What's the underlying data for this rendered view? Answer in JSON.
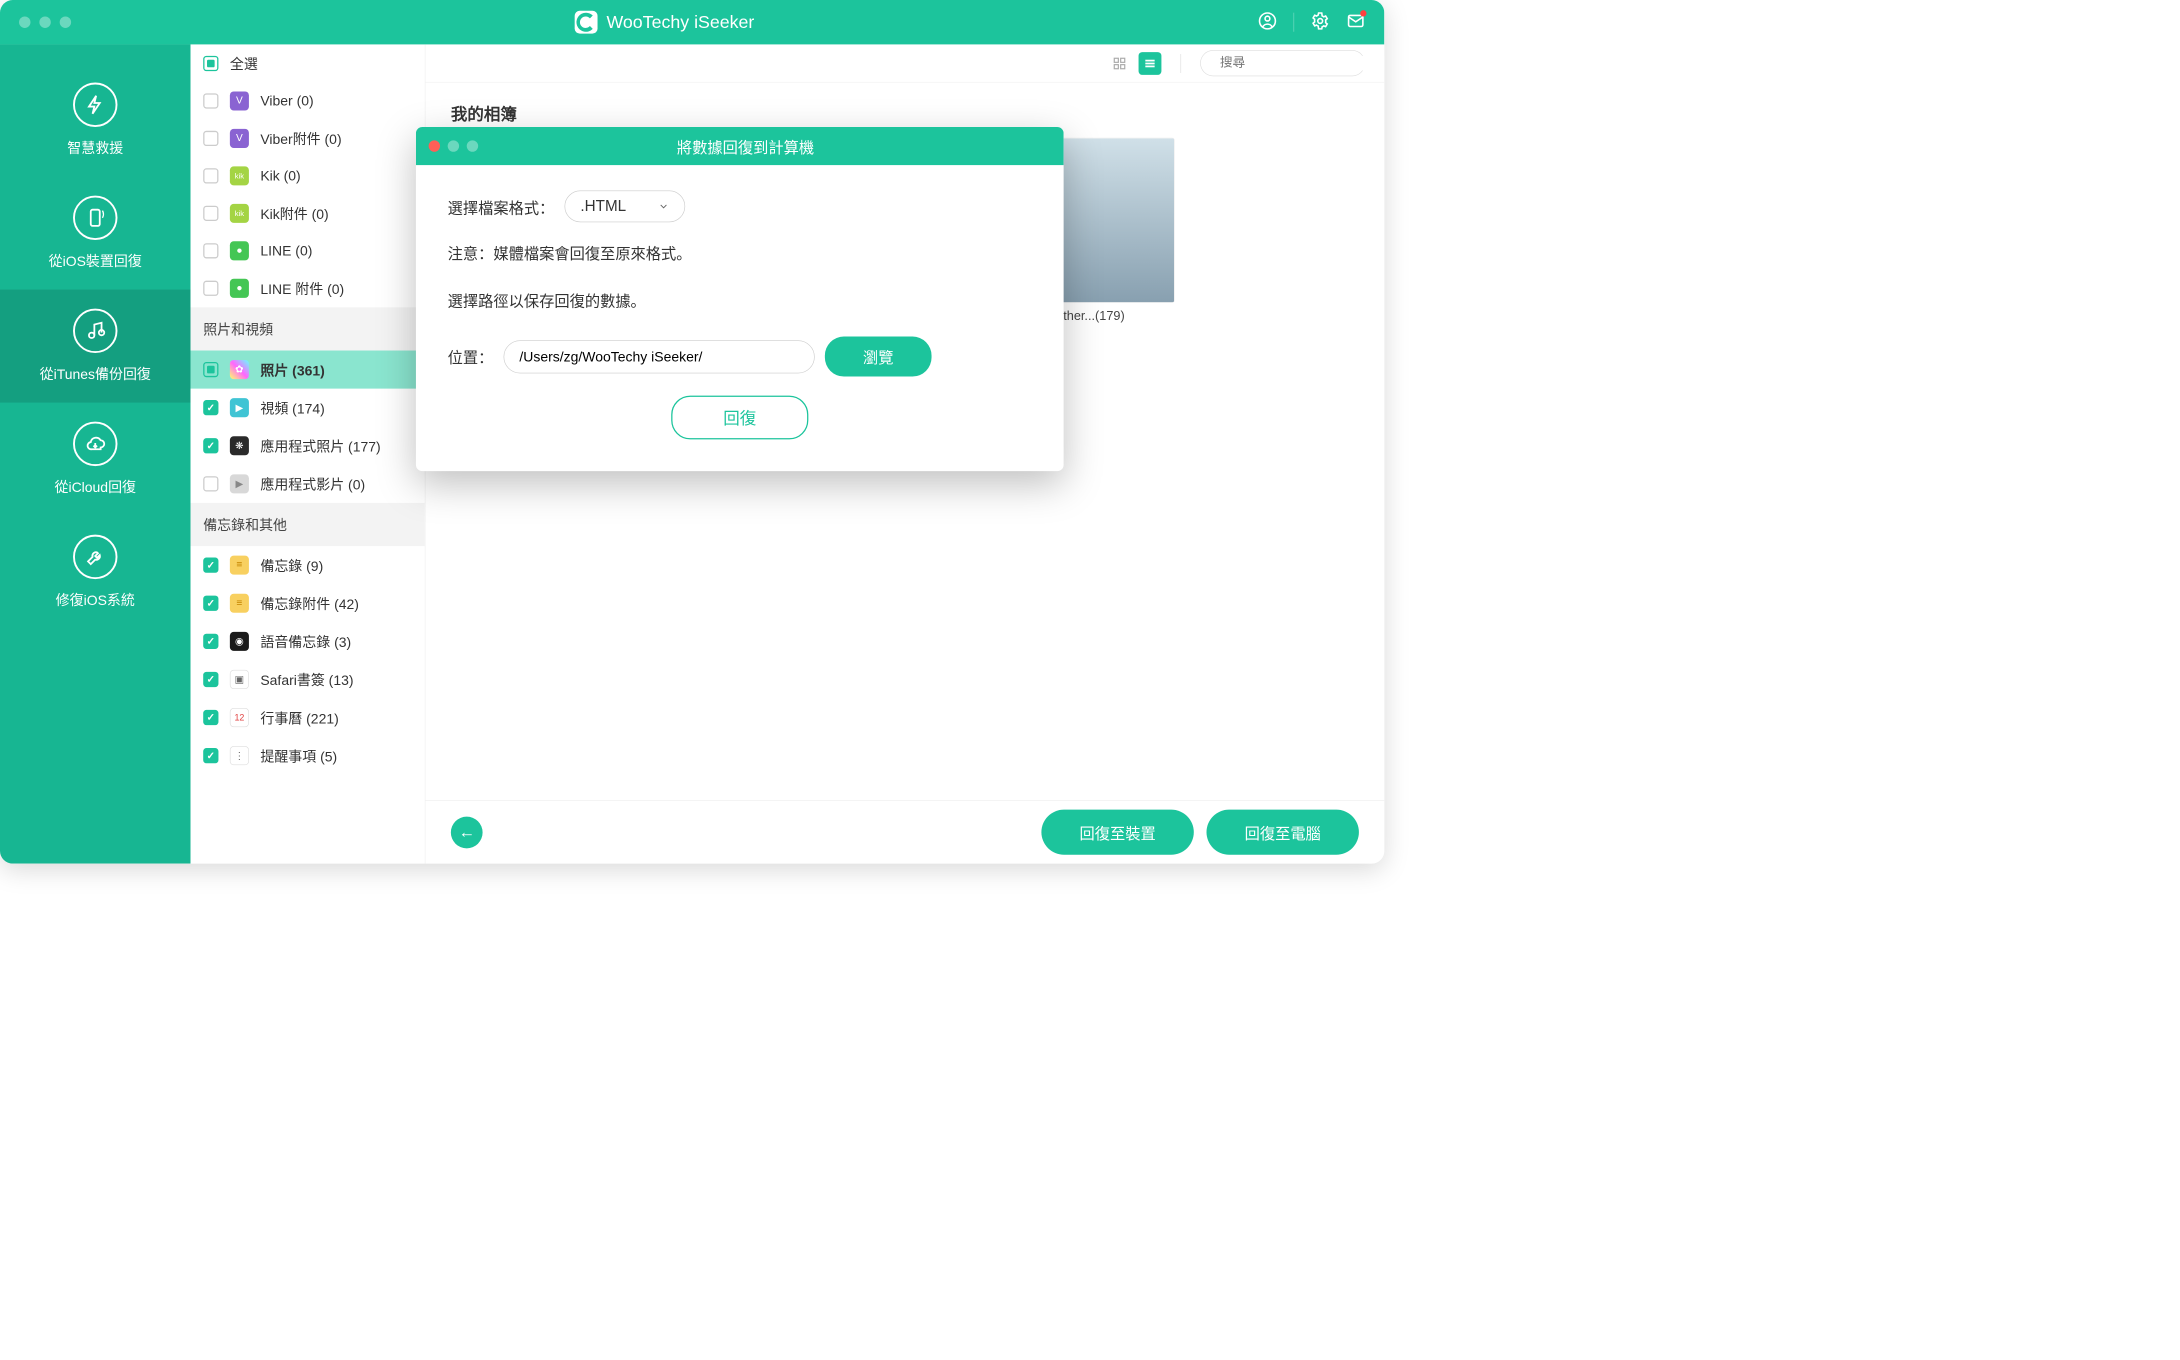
{
  "app": {
    "title": "WooTechy iSeeker"
  },
  "nav": {
    "items": [
      {
        "label": "智慧救援"
      },
      {
        "label": "從iOS裝置回復"
      },
      {
        "label": "從iTunes備份回復"
      },
      {
        "label": "從iCloud回復"
      },
      {
        "label": "修復iOS系統"
      }
    ]
  },
  "sidebar": {
    "select_all": "全選",
    "top_items": [
      {
        "label": "Viber (0)",
        "iconbg": "#8a63d2"
      },
      {
        "label": "Viber附件 (0)",
        "iconbg": "#8a63d2"
      },
      {
        "label": "Kik (0)",
        "iconbg": "#7cc644"
      },
      {
        "label": "Kik附件 (0)",
        "iconbg": "#7cc644"
      },
      {
        "label": "LINE (0)",
        "iconbg": "#44c654"
      },
      {
        "label": "LINE 附件 (0)",
        "iconbg": "#44c654"
      }
    ],
    "section_photos": "照片和視頻",
    "photo_items": [
      {
        "label": "照片 (361)",
        "selected": true,
        "checked": "partial",
        "iconbg": "#ffb400"
      },
      {
        "label": "視頻 (174)",
        "checked": "checked",
        "iconbg": "#40c4d4"
      },
      {
        "label": "應用程式照片 (177)",
        "checked": "checked",
        "iconbg": "#e04848"
      },
      {
        "label": "應用程式影片 (0)",
        "checked": "unchecked",
        "iconbg": "#c8c8c8"
      }
    ],
    "section_memo": "備忘錄和其他",
    "memo_items": [
      {
        "label": "備忘錄 (9)",
        "iconbg": "#f8c040"
      },
      {
        "label": "備忘錄附件 (42)",
        "iconbg": "#f8c040"
      },
      {
        "label": "語音備忘錄 (3)",
        "iconbg": "#202020"
      },
      {
        "label": "Safari書簽 (13)",
        "iconbg": "#888888"
      },
      {
        "label": "行事曆 (221)",
        "iconbg": "#ffffff"
      },
      {
        "label": "提醒事項 (5)",
        "iconbg": "#ffffff"
      }
    ]
  },
  "search": {
    "placeholder": "搜尋"
  },
  "main": {
    "album_title": "我的相簿",
    "albums": [
      {
        "caption": ""
      },
      {
        "caption": ""
      },
      {
        "caption": ""
      },
      {
        "caption": "Other...(179)"
      }
    ]
  },
  "footer": {
    "restore_device": "回復至裝置",
    "restore_pc": "回復至電腦"
  },
  "modal": {
    "title": "將數據回復到計算機",
    "format_label": "選擇檔案格式：",
    "format_value": ".HTML",
    "note": "注意：媒體檔案會回復至原來格式。",
    "path_label": "選擇路徑以保存回復的數據。",
    "location_label": "位置：",
    "path_value": "/Users/zg/WooTechy iSeeker/",
    "browse": "瀏覽",
    "recover": "回復"
  }
}
